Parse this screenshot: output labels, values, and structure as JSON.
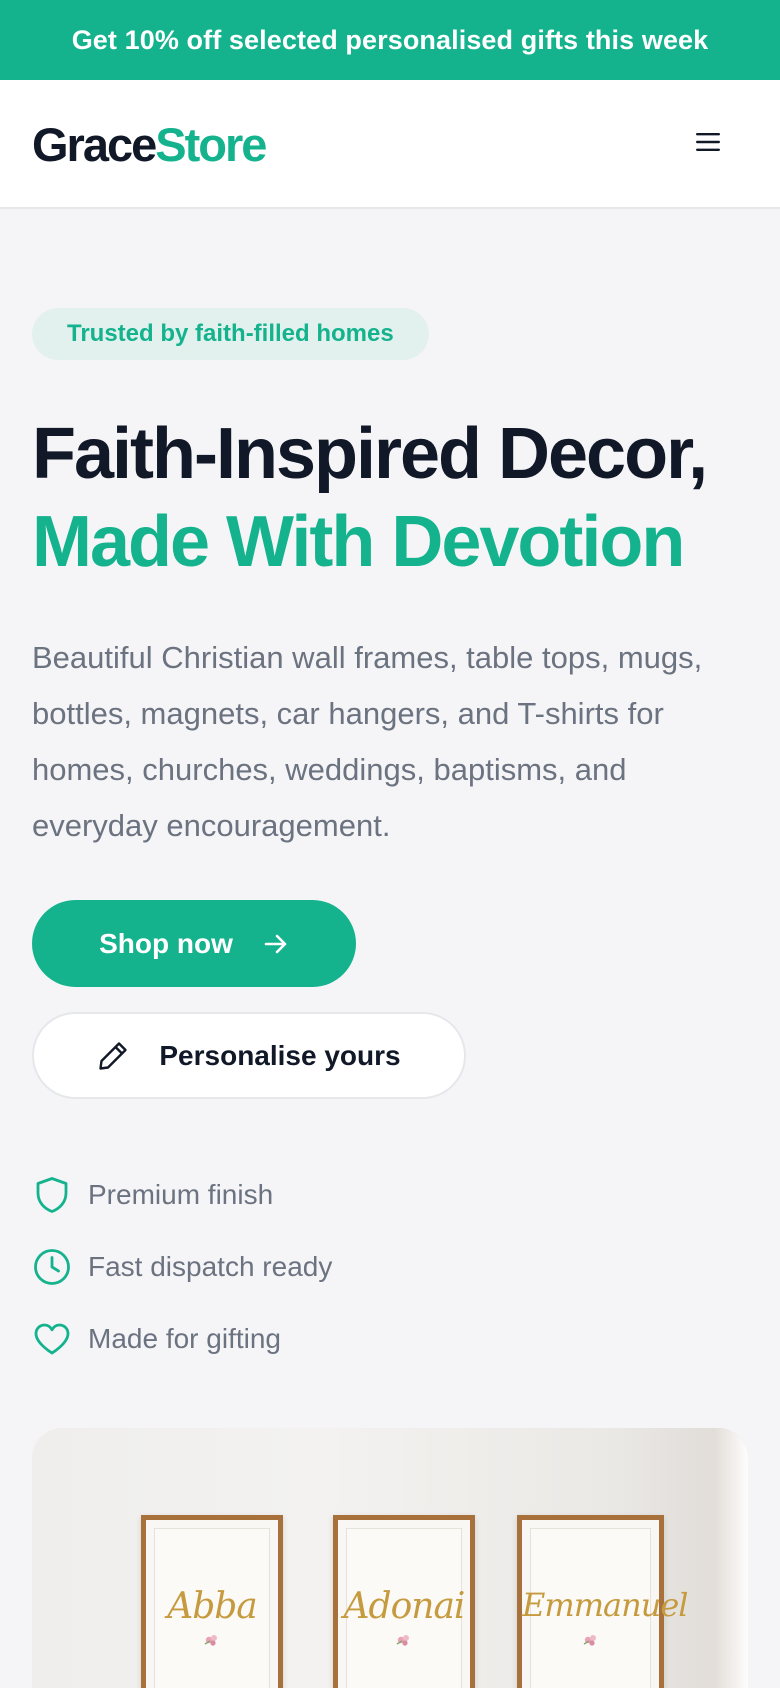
{
  "promo": {
    "text": "Get 10% off selected personalised gifts this week"
  },
  "header": {
    "logo_part1": "Grace",
    "logo_part2": "Store",
    "menu_icon": "hamburger-menu-icon"
  },
  "hero": {
    "badge": "Trusted by faith-filled homes",
    "headline_line1": "Faith-Inspired Decor,",
    "headline_line2": "Made With Devotion",
    "description": "Beautiful Christian wall frames, table tops, mugs, bottles, magnets, car hangers, and T-shirts for homes, churches, weddings, baptisms, and everyday encouragement.",
    "primary_cta": {
      "label": "Shop now",
      "icon": "arrow-right-icon"
    },
    "secondary_cta": {
      "label": "Personalise yours",
      "icon": "pencil-icon"
    }
  },
  "features": [
    {
      "label": "Premium finish",
      "icon": "shield-icon"
    },
    {
      "label": "Fast dispatch ready",
      "icon": "clock-icon"
    },
    {
      "label": "Made for gifting",
      "icon": "heart-icon"
    }
  ],
  "hero_image": {
    "frames": [
      {
        "word": "Abba"
      },
      {
        "word": "Adonai"
      },
      {
        "word": "Emmanuel"
      }
    ]
  },
  "colors": {
    "accent": "#14b38e",
    "text_dark": "#111827",
    "text_muted": "#6b7280",
    "background": "#f5f5f7",
    "badge_bg": "#e3f1ee",
    "frame_wood": "#a8703a",
    "script_gold": "#c69a3e"
  }
}
